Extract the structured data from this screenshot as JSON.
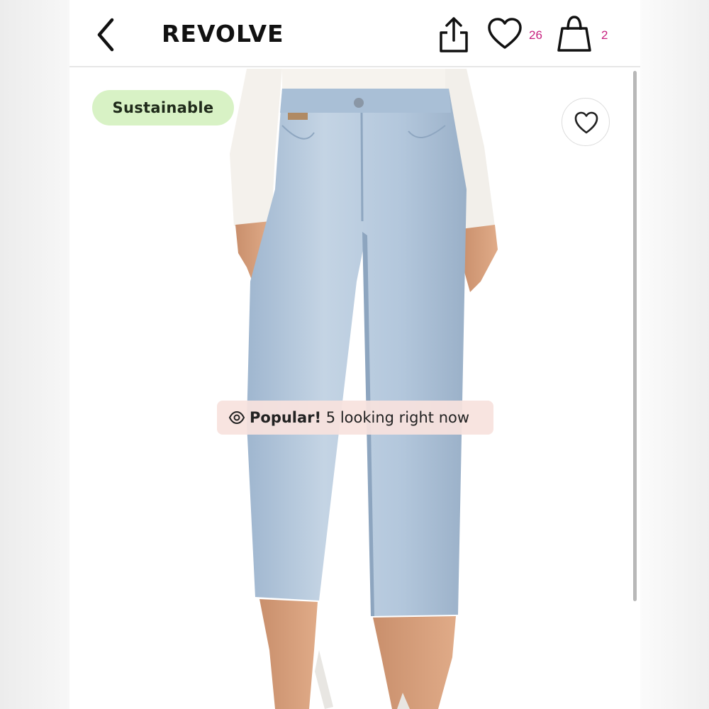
{
  "app": {
    "brand": "REVOLVE"
  },
  "header": {
    "wishlist_count": "26",
    "bag_count": "2"
  },
  "product": {
    "badge": "Sustainable",
    "popular_label": "Popular!",
    "popular_text": "5 looking right now"
  },
  "icons": {
    "back": "chevron-left-icon",
    "share": "share-icon",
    "wishlist": "heart-icon",
    "bag": "shopping-bag-icon",
    "favorite": "heart-icon",
    "eye": "eye-icon"
  },
  "colors": {
    "accent": "#c8207f",
    "badge_bg": "#d8f2c5",
    "popular_bg": "#f8e2de"
  }
}
